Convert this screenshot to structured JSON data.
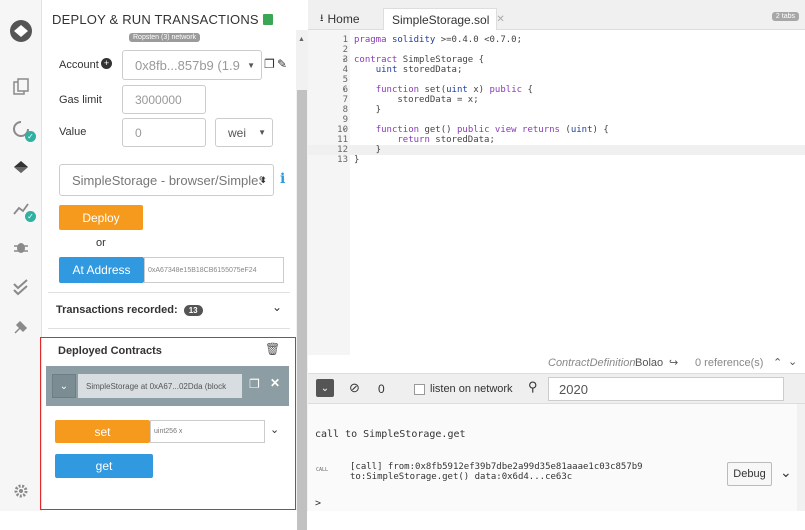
{
  "sidebar": {
    "icons": [
      "remix-logo-icon",
      "files-icon",
      "compile-icon",
      "deploy-run-icon",
      "analysis-icon",
      "debugger-icon",
      "test-icon",
      "plugin-icon",
      "settings-icon"
    ]
  },
  "panel": {
    "title": "DEPLOY & RUN TRANSACTIONS",
    "network_badge": "Ropsten (3) network",
    "account_label": "Account",
    "account_value": "0x8fb...857b9 (1.9",
    "gas_limit_label": "Gas limit",
    "gas_limit_value": "3000000",
    "value_label": "Value",
    "value_amount": "0",
    "value_unit": "wei",
    "contract_select": "SimpleStorage - browser/SimpleS",
    "deploy_label": "Deploy",
    "or_label": "or",
    "at_address_label": "At Address",
    "at_address_value": "0xA67348e15B18CB6155075eF24",
    "transactions_label": "Transactions recorded:",
    "transactions_count": "13",
    "deployed_title": "Deployed Contracts",
    "instance_label": "SimpleStorage at 0xA67...02Dda (block",
    "set_label": "set",
    "set_placeholder": "uint256 x",
    "get_label": "get"
  },
  "tabs": {
    "home": "Home",
    "file": "SimpleStorage.sol",
    "count": "2 tabs"
  },
  "editor": {
    "lines": [
      {
        "n": "1",
        "fold": "",
        "code": "pragma solidity >=0.4.0 <0.7.0;"
      },
      {
        "n": "2",
        "fold": "",
        "code": ""
      },
      {
        "n": "3",
        "fold": "▾",
        "code": "contract SimpleStorage {"
      },
      {
        "n": "4",
        "fold": "",
        "code": "    uint storedData;"
      },
      {
        "n": "5",
        "fold": "",
        "code": ""
      },
      {
        "n": "6",
        "fold": "▾",
        "code": "    function set(uint x) public {"
      },
      {
        "n": "7",
        "fold": "",
        "code": "        storedData = x;"
      },
      {
        "n": "8",
        "fold": "",
        "code": "    }"
      },
      {
        "n": "9",
        "fold": "",
        "code": ""
      },
      {
        "n": "10",
        "fold": "▾",
        "code": "    function get() public view returns (uint) {"
      },
      {
        "n": "11",
        "fold": "",
        "code": "        return storedData;"
      },
      {
        "n": "12",
        "fold": "",
        "code": "    }"
      },
      {
        "n": "13",
        "fold": "",
        "code": "}"
      }
    ]
  },
  "statusbar": {
    "definition": "ContractDefinition",
    "name": "Bolao",
    "references": "0 reference(s)"
  },
  "terminal": {
    "count": "0",
    "listen_label": "listen on network",
    "search_value": "2020",
    "call_text": "call to SimpleStorage.get",
    "call_tag": "CALL",
    "call_line1": "[call]  from:0x8fb5912ef39b7dbe2a99d35e81aaae1c03c857b9",
    "call_line2": "to:SimpleStorage.get() data:0x6d4...ce63c",
    "debug_label": "Debug",
    "prompt": ">"
  },
  "colors": {
    "orange": "#f59a1c",
    "blue": "#3199e0",
    "highlight": "#e02b2b",
    "instance_header": "#8c9ea3"
  }
}
